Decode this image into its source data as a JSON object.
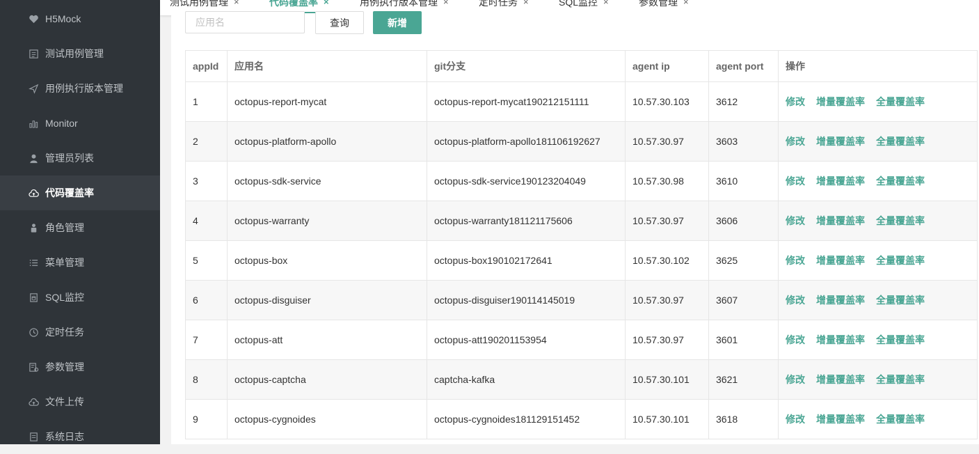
{
  "sidebar": {
    "items": [
      {
        "label": "H5Mock",
        "icon": "heart-icon",
        "active": false
      },
      {
        "label": "测试用例管理",
        "icon": "list-doc-icon",
        "active": false
      },
      {
        "label": "用例执行版本管理",
        "icon": "send-icon",
        "active": false
      },
      {
        "label": "Monitor",
        "icon": "bar-chart-icon",
        "active": false
      },
      {
        "label": "管理员列表",
        "icon": "user-icon",
        "active": false
      },
      {
        "label": "代码覆盖率",
        "icon": "cloud-upload-icon",
        "active": true
      },
      {
        "label": "角色管理",
        "icon": "role-icon",
        "active": false
      },
      {
        "label": "菜单管理",
        "icon": "menu-list-icon",
        "active": false
      },
      {
        "label": "SQL监控",
        "icon": "database-doc-icon",
        "active": false
      },
      {
        "label": "定时任务",
        "icon": "clock-icon",
        "active": false
      },
      {
        "label": "参数管理",
        "icon": "settings-doc-icon",
        "active": false
      },
      {
        "label": "文件上传",
        "icon": "cloud-upload-icon",
        "active": false
      },
      {
        "label": "系统日志",
        "icon": "log-doc-icon",
        "active": false
      }
    ]
  },
  "tabs": [
    {
      "label": "测试用例管理",
      "close": "×",
      "active": false
    },
    {
      "label": "代码覆盖率",
      "close": "×",
      "active": true
    },
    {
      "label": "用例执行版本管理",
      "close": "×",
      "active": false
    },
    {
      "label": "定时任务",
      "close": "×",
      "active": false
    },
    {
      "label": "SQL监控",
      "close": "×",
      "active": false
    },
    {
      "label": "参数管理",
      "close": "×",
      "active": false
    }
  ],
  "toolbar": {
    "search_placeholder": "应用名",
    "query_label": "查询",
    "add_label": "新增"
  },
  "table": {
    "headers": [
      "appId",
      "应用名",
      "git分支",
      "agent ip",
      "agent port",
      "操作"
    ],
    "actions": [
      "修改",
      "增量覆盖率",
      "全量覆盖率"
    ],
    "rows": [
      {
        "appId": "1",
        "name": "octopus-report-mycat",
        "branch": "octopus-report-mycat190212151111",
        "ip": "10.57.30.103",
        "port": "3612"
      },
      {
        "appId": "2",
        "name": "octopus-platform-apollo",
        "branch": "octopus-platform-apollo181106192627",
        "ip": "10.57.30.97",
        "port": "3603"
      },
      {
        "appId": "3",
        "name": "octopus-sdk-service",
        "branch": "octopus-sdk-service190123204049",
        "ip": "10.57.30.98",
        "port": "3610"
      },
      {
        "appId": "4",
        "name": "octopus-warranty",
        "branch": "octopus-warranty181121175606",
        "ip": "10.57.30.97",
        "port": "3606"
      },
      {
        "appId": "5",
        "name": "octopus-box",
        "branch": "octopus-box190102172641",
        "ip": "10.57.30.102",
        "port": "3625"
      },
      {
        "appId": "6",
        "name": "octopus-disguiser",
        "branch": "octopus-disguiser190114145019",
        "ip": "10.57.30.97",
        "port": "3607"
      },
      {
        "appId": "7",
        "name": "octopus-att",
        "branch": "octopus-att190201153954",
        "ip": "10.57.30.97",
        "port": "3601"
      },
      {
        "appId": "8",
        "name": "octopus-captcha",
        "branch": "captcha-kafka",
        "ip": "10.57.30.101",
        "port": "3621"
      },
      {
        "appId": "9",
        "name": "octopus-cygnoides",
        "branch": "octopus-cygnoides181129151452",
        "ip": "10.57.30.101",
        "port": "3618"
      }
    ]
  },
  "colors": {
    "accent": "#4aa694",
    "sidebar_bg": "#2f3439",
    "sidebar_active": "#393e44"
  }
}
